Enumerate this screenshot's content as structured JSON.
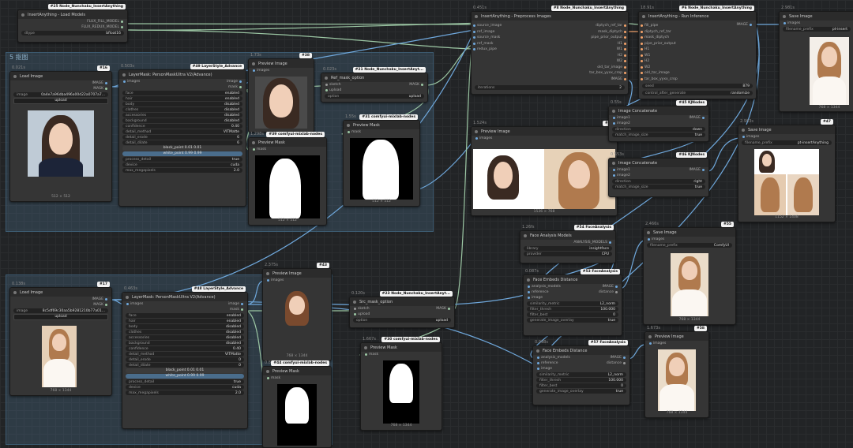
{
  "groups": {
    "top_group_title": "5 抠图",
    "bottom_group_title": ""
  },
  "nodes": {
    "n25": {
      "badge": "#25 Node_Nunchaku_InsertAnything",
      "title": "InsertAnything - Load Models",
      "out1": "FLUX_FILL_MODEL",
      "out2": "FLUX_REDUX_MODEL",
      "dtype_label": "dtype",
      "dtype_value": "bfloat16"
    },
    "n16": {
      "badge": "#16",
      "timing": "0.021s",
      "title": "Load Image",
      "out1": "IMAGE",
      "out2": "MASK",
      "image_label": "image",
      "image_value": "0a4e7a96dba496a00d22a0707a7...",
      "upload": "upload",
      "caption": "512 × 512"
    },
    "n49": {
      "badge": "#49 LayerStyle_Advance",
      "timing": "0.503s",
      "title": "LayerMask: PersonMaskUltra V2(Advance)",
      "in1": "images",
      "out1": "image",
      "out2": "mask",
      "rows": [
        [
          "face",
          "enabled"
        ],
        [
          "hair",
          "enabled"
        ],
        [
          "body",
          "disabled"
        ],
        [
          "clothes",
          "disabled"
        ],
        [
          "accessories",
          "disabled"
        ],
        [
          "background",
          "disabled"
        ],
        [
          "confidence",
          "0.40"
        ],
        [
          "detail_method",
          "VITMatte"
        ],
        [
          "detail_erode",
          "6"
        ],
        [
          "detail_dilate",
          "6"
        ]
      ],
      "black_point": "black_point 0.01 0.01",
      "white_point": "white_point 0.99 0.99",
      "rows2": [
        [
          "process_detail",
          "true"
        ],
        [
          "device",
          "cuda"
        ],
        [
          "max_megapixels",
          "2.0"
        ]
      ]
    },
    "n38": {
      "badge": "#38",
      "timing": "1.73s",
      "title": "Preview Image",
      "in1": "images"
    },
    "n39": {
      "badge": "#39 comfyui-mixlab-nodes",
      "timing": "1.298s",
      "title": "Preview Mask",
      "in1": "mask",
      "caption": "512 × 512"
    },
    "n21": {
      "badge": "#21 Node_Nunchaku_InsertAnyt...",
      "timing": "0.023s",
      "title": "Ref_mask_option",
      "in1": "sketch",
      "in2": "upload",
      "out1": "MASK",
      "w_label": "option",
      "w_value": "upload"
    },
    "n31": {
      "badge": "#31 comfyui-mixlab-nodes",
      "timing": "1.55s",
      "title": "Preview Mask",
      "in1": "mask",
      "caption": "512 × 512"
    },
    "n8": {
      "badge": "#8 Node_Nunchaku_InsertAnything",
      "timing": "0.451s",
      "title": "InsertAnything - Preprocess Images",
      "ins": [
        "source_image",
        "ref_image",
        "source_mask",
        "ref_mask",
        "redux_pipe"
      ],
      "outs": [
        "diptych_ref_tar",
        "mask_diptych",
        "pipe_prior_output",
        "H1",
        "W1",
        "H2",
        "W2",
        "old_tar_image",
        "tar_box_yyxx_crop",
        "IMAGE"
      ],
      "w_label": "iterations",
      "w_value": "2"
    },
    "n6": {
      "badge": "#6 Node_Nunchaku_InsertAnything",
      "timing": "18.91s",
      "title": "InsertAnything - Run Inference",
      "ins": [
        "fill_pipe",
        "diptych_ref_tar",
        "mask_diptych",
        "pipe_prior_output",
        "H1",
        "W1",
        "H2",
        "W2",
        "old_tar_image",
        "tar_box_yyxx_crop"
      ],
      "out1": "IMAGE",
      "seed_label": "seed",
      "seed_value": "879",
      "ctl_label": "control_after_generate",
      "ctl_value": "randomize"
    },
    "n9": {
      "timing": "2.981s",
      "title": "Save Image",
      "in1": "images",
      "w_label": "filename_prefix",
      "w_value": "pt-insert",
      "caption": "768 × 1344"
    },
    "n18": {
      "badge": "#18",
      "timing": "1.524s",
      "title": "Preview Image",
      "in1": "images",
      "caption": "1536 × 768"
    },
    "n45": {
      "badge": "#45 KJNodes",
      "timing": "0.55s",
      "title": "Image Concatenate",
      "in1": "image1",
      "in2": "image2",
      "out1": "IMAGE",
      "dir_label": "direction",
      "dir_value": "down",
      "match_label": "match_image_size",
      "match_value": "true"
    },
    "n46": {
      "badge": "#46 KJNodes",
      "timing": "0.553s",
      "title": "Image Concatenate",
      "in1": "image1",
      "in2": "image2",
      "out1": "IMAGE",
      "dir_label": "direction",
      "dir_value": "right",
      "match_label": "match_image_size",
      "match_value": "true"
    },
    "n47": {
      "badge": "#47",
      "timing": "2.983s",
      "title": "Save Image",
      "in1": "images",
      "w_label": "filename_prefix",
      "w_value": "pt-insertAnything",
      "caption": "1152 × 1408"
    },
    "n54": {
      "badge": "#54 FaceAnalysis",
      "timing": "1.26fs",
      "title": "Face Analysis Models",
      "out1": "ANALYSIS_MODELS",
      "lib_label": "library",
      "lib_value": "insightface",
      "prov_label": "provider",
      "prov_value": "CPU"
    },
    "n53": {
      "badge": "#53 FaceAnalysis",
      "timing": "0.087s",
      "title": "Face Embeds Distance",
      "ins": [
        "analysis_models",
        "reference",
        "image"
      ],
      "out1": "IMAGE",
      "out2": "distance",
      "rows": [
        [
          "similarity_metric",
          "L2_norm"
        ],
        [
          "filter_thresh",
          "100.000"
        ],
        [
          "filter_best",
          "0"
        ],
        [
          "generate_image_overlay",
          "true"
        ]
      ]
    },
    "n57": {
      "badge": "#57 FaceAnalysis",
      "timing": "0.098s",
      "title": "Face Embeds Distance",
      "ins": [
        "analysis_models",
        "reference",
        "image"
      ],
      "out1": "IMAGE",
      "out2": "distance",
      "rows": [
        [
          "similarity_metric",
          "L2_norm"
        ],
        [
          "filter_thresh",
          "100.000"
        ],
        [
          "filter_best",
          "0"
        ],
        [
          "generate_image_overlay",
          "true"
        ]
      ]
    },
    "n55": {
      "badge": "#55",
      "timing": "2.466s",
      "title": "Save Image",
      "in1": "images",
      "w_label": "filename_prefix",
      "w_value": "ComfyUI",
      "caption": "768 × 1344"
    },
    "n58": {
      "badge": "#58",
      "timing": "1.673s",
      "title": "Preview Image",
      "in1": "images",
      "caption": "768 × 1344"
    },
    "n17": {
      "badge": "#17",
      "timing": "0.138s",
      "title": "Load Image",
      "out1": "IMAGE",
      "out2": "MASK",
      "image_label": "image",
      "image_value": "8c5df69c30aa5b9281210b77a01...",
      "upload": "upload",
      "caption": "768 × 1344"
    },
    "n48": {
      "badge": "#48 LayerStyle_Advance",
      "timing": "0.463s",
      "title": "LayerMask: PersonMaskUltra V2(Advance)",
      "in1": "images",
      "out1": "image",
      "out2": "mask",
      "rows": [
        [
          "face",
          "enabled"
        ],
        [
          "hair",
          "enabled"
        ],
        [
          "body",
          "disabled"
        ],
        [
          "clothes",
          "disabled"
        ],
        [
          "accessories",
          "disabled"
        ],
        [
          "background",
          "disabled"
        ],
        [
          "confidence",
          "0.40"
        ],
        [
          "detail_method",
          "VITMatte"
        ],
        [
          "detail_erode",
          "0"
        ],
        [
          "detail_dilate",
          "0"
        ]
      ],
      "black_point": "black_point 0.01 0.01",
      "white_point": "white_point 0.99 0.99",
      "rows2": [
        [
          "process_detail",
          "true"
        ],
        [
          "device",
          "cuda"
        ],
        [
          "max_megapixels",
          "2.0"
        ]
      ]
    },
    "n43": {
      "badge": "#43",
      "timing": "2.375s",
      "title": "Preview Image",
      "in1": "images",
      "caption": "768 × 1344"
    },
    "n44": {
      "badge": "#44 comfyui-mixlab-nodes",
      "timing": "0.886s",
      "title": "Preview Mask",
      "in1": "mask"
    },
    "n23": {
      "badge": "#23 Node_Nunchaku_InsertAnyt...",
      "timing": "0.120s",
      "title": "Src_mask_option",
      "in1": "sketch",
      "in2": "upload",
      "out1": "MASK",
      "w_label": "option",
      "w_value": "upload"
    },
    "n30": {
      "badge": "#30 comfyui-mixlab-nodes",
      "timing": "1.667s",
      "title": "Preview Mask",
      "in1": "mask",
      "caption": "768 × 1344"
    }
  }
}
